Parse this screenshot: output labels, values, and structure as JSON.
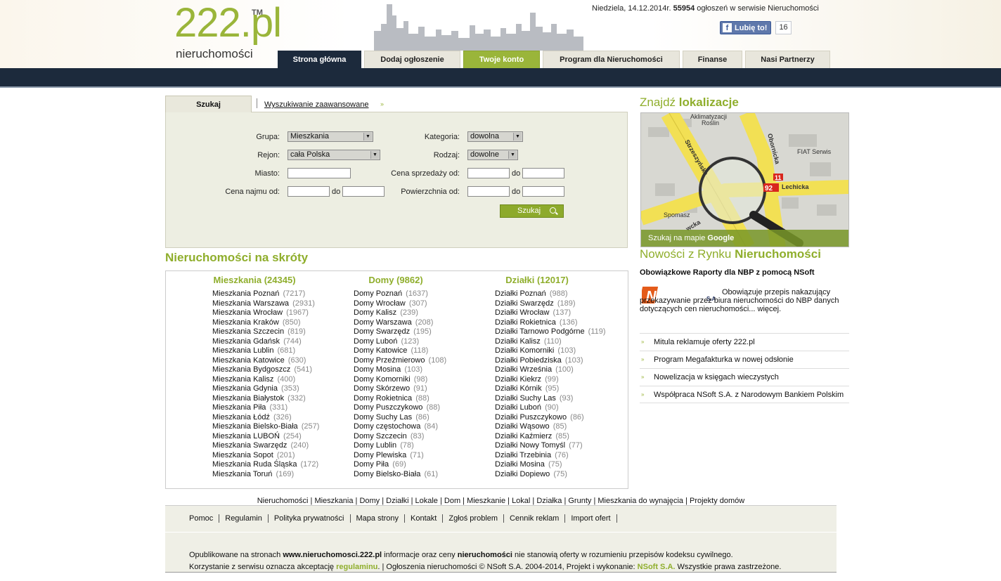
{
  "brand": {
    "logo_number": "222.pl",
    "logo_tm": "TM",
    "logo_sub": "nieruchomości"
  },
  "topbar": {
    "date": "Niedziela, 14.12.2014r.",
    "listings_count": "55954",
    "listings_text": "ogłoszeń w serwisie Nieruchomości",
    "fb_like_label": "Lubię to!",
    "fb_like_count": "16"
  },
  "tabs": [
    {
      "label": "Strona główna"
    },
    {
      "label": "Dodaj ogłoszenie"
    },
    {
      "label": "Twoje konto"
    },
    {
      "label": "Program dla Nieruchomości"
    },
    {
      "label": "Finanse"
    },
    {
      "label": "Nasi Partnerzy"
    }
  ],
  "search": {
    "tab_label": "Szukaj",
    "advanced_link": "Wyszukiwanie zaawansowane",
    "advanced_arrow": "»",
    "group_label": "Grupa:",
    "group_value": "Mieszkania",
    "region_label": "Rejon:",
    "region_value": "cała Polska",
    "city_label": "Miasto:",
    "rent_label": "Cena najmu od:",
    "category_label": "Kategoria:",
    "category_value": "dowolna",
    "type_label": "Rodzaj:",
    "type_value": "dowolne",
    "sale_label": "Cena sprzedaży od:",
    "area_label": "Powierzchnia od:",
    "to_label": "do",
    "submit_label": "Szukaj"
  },
  "shortcuts": {
    "title": "Nieruchomości na skróty",
    "columns": [
      {
        "title": "Mieszkania (24345)",
        "items": [
          {
            "name": "Mieszkania Poznań",
            "count": "(7217)"
          },
          {
            "name": "Mieszkania Warszawa",
            "count": "(2931)"
          },
          {
            "name": "Mieszkania Wrocław",
            "count": "(1967)"
          },
          {
            "name": "Mieszkania Kraków",
            "count": "(850)"
          },
          {
            "name": "Mieszkania Szczecin",
            "count": "(819)"
          },
          {
            "name": "Mieszkania Gdańsk",
            "count": "(744)"
          },
          {
            "name": "Mieszkania Lublin",
            "count": "(681)"
          },
          {
            "name": "Mieszkania Katowice",
            "count": "(630)"
          },
          {
            "name": "Mieszkania Bydgoszcz",
            "count": "(541)"
          },
          {
            "name": "Mieszkania Kalisz",
            "count": "(400)"
          },
          {
            "name": "Mieszkania Gdynia",
            "count": "(353)"
          },
          {
            "name": "Mieszkania Białystok",
            "count": "(332)"
          },
          {
            "name": "Mieszkania Piła",
            "count": "(331)"
          },
          {
            "name": "Mieszkania Łódź",
            "count": "(326)"
          },
          {
            "name": "Mieszkania Bielsko-Biała",
            "count": "(257)"
          },
          {
            "name": "Mieszkania LUBOŃ",
            "count": "(254)"
          },
          {
            "name": "Mieszkania Swarzędz",
            "count": "(240)"
          },
          {
            "name": "Mieszkania Sopot",
            "count": "(201)"
          },
          {
            "name": "Mieszkania Ruda Śląska",
            "count": "(172)"
          },
          {
            "name": "Mieszkania Toruń",
            "count": "(169)"
          }
        ]
      },
      {
        "title": "Domy (9862)",
        "items": [
          {
            "name": "Domy Poznań",
            "count": "(1637)"
          },
          {
            "name": "Domy Wrocław",
            "count": "(307)"
          },
          {
            "name": "Domy Kalisz",
            "count": "(239)"
          },
          {
            "name": "Domy Warszawa",
            "count": "(208)"
          },
          {
            "name": "Domy Swarzędz",
            "count": "(195)"
          },
          {
            "name": "Domy Luboń",
            "count": "(123)"
          },
          {
            "name": "Domy Katowice",
            "count": "(118)"
          },
          {
            "name": "Domy Przeźmierowo",
            "count": "(108)"
          },
          {
            "name": "Domy Mosina",
            "count": "(103)"
          },
          {
            "name": "Domy Komorniki",
            "count": "(98)"
          },
          {
            "name": "Domy Skórzewo",
            "count": "(91)"
          },
          {
            "name": "Domy Rokietnica",
            "count": "(88)"
          },
          {
            "name": "Domy Puszczykowo",
            "count": "(88)"
          },
          {
            "name": "Domy Suchy Las",
            "count": "(86)"
          },
          {
            "name": "Domy częstochowa",
            "count": "(84)"
          },
          {
            "name": "Domy Szczecin",
            "count": "(83)"
          },
          {
            "name": "Domy Lublin",
            "count": "(78)"
          },
          {
            "name": "Domy Plewiska",
            "count": "(71)"
          },
          {
            "name": "Domy Piła",
            "count": "(69)"
          },
          {
            "name": "Domy Bielsko-Biała",
            "count": "(61)"
          }
        ]
      },
      {
        "title": "Działki (12017)",
        "items": [
          {
            "name": "Działki Poznań",
            "count": "(988)"
          },
          {
            "name": "Działki Swarzędz",
            "count": "(189)"
          },
          {
            "name": "Działki Wrocław",
            "count": "(137)"
          },
          {
            "name": "Działki Rokietnica",
            "count": "(136)"
          },
          {
            "name": "Działki Tarnowo Podgórne",
            "count": "(119)"
          },
          {
            "name": "Działki Kalisz",
            "count": "(110)"
          },
          {
            "name": "Działki Komorniki",
            "count": "(103)"
          },
          {
            "name": "Działki Pobiedziska",
            "count": "(103)"
          },
          {
            "name": "Działki Września",
            "count": "(100)"
          },
          {
            "name": "Działki Kiekrz",
            "count": "(99)"
          },
          {
            "name": "Działki Kórnik",
            "count": "(95)"
          },
          {
            "name": "Działki Suchy Las",
            "count": "(93)"
          },
          {
            "name": "Działki Luboń",
            "count": "(90)"
          },
          {
            "name": "Działki Puszczykowo",
            "count": "(86)"
          },
          {
            "name": "Działki Wąsowo",
            "count": "(85)"
          },
          {
            "name": "Działki Kaźmierz",
            "count": "(85)"
          },
          {
            "name": "Działki Nowy Tomyśl",
            "count": "(77)"
          },
          {
            "name": "Działki Trzebinia",
            "count": "(76)"
          },
          {
            "name": "Działki Mosina",
            "count": "(75)"
          },
          {
            "name": "Działki Dopiewo",
            "count": "(75)"
          }
        ]
      }
    ]
  },
  "map": {
    "title_plain": "Znajdź ",
    "title_bold": "lokalizacje",
    "caption_plain": "Szukaj na mapie ",
    "caption_bold": "Google",
    "labels": {
      "aklimatyzacji": "Aklimatyzacji",
      "roslin": "Roślin",
      "strzeszynska": "Strzeszyńska",
      "obornicka": "Obornicka",
      "fiat": "FIAT Serwis",
      "lechicka": "Lechicka",
      "route_92": "92",
      "route_11": "11",
      "spomasz": "Spomasz",
      "street_partial": "wcka"
    }
  },
  "news": {
    "title_plain": "Nowości z Rynku ",
    "title_bold": "Nieruchomości",
    "headline": "Obowiązkowe Raporty dla NBP z pomocą NSoft",
    "logo_text": "NSOFT",
    "logo_suffix": "S.A",
    "body": "Obowiązuje przepis nakazujący przekazywanie przez biura nieruchomości do NBP danych dotyczących cen nieruchomości... więcej.",
    "items": [
      {
        "label": "Mitula reklamuje oferty 222.pl"
      },
      {
        "label": "Program Megafakturka w nowej odsłonie"
      },
      {
        "label": "Nowelizacja w księgach wieczystych"
      },
      {
        "label": "Współpraca NSoft S.A. z Narodowym Bankiem Polskim"
      }
    ],
    "arrow": "»"
  },
  "footer": {
    "links_line": "Nieruchomości | Mieszkania | Domy | Działki | Lokale | Dom | Mieszkanie | Lokal | Działka | Grunty | Mieszkania do wynajęcia | Projekty domów",
    "nav": [
      {
        "label": "Pomoc"
      },
      {
        "label": "Regulamin"
      },
      {
        "label": "Polityka prywatności"
      },
      {
        "label": "Mapa strony"
      },
      {
        "label": "Kontakt"
      },
      {
        "label": "Zgłoś problem"
      },
      {
        "label": "Cennik reklam"
      },
      {
        "label": "Import ofert"
      }
    ],
    "info1_a": "Opublikowane na stronach ",
    "info1_site": "www.nieruchomosci.222.pl",
    "info1_b": " informacje oraz ceny ",
    "info1_bold": "nieruchomości",
    "info1_c": " nie stanowią oferty w rozumieniu przepisów kodeksu cywilnego.",
    "info2_a": "Korzystanie z serwisu oznacza akceptację ",
    "info2_link": "regulaminu",
    "info2_b": ". | Ogłoszenia nieruchomości © NSoft S.A. 2004-2014, Projekt i wykonanie: ",
    "info2_author": "NSoft S.A.",
    "info2_c": " Wszystkie prawa zastrzeżone."
  },
  "colors": {
    "accent_green": "#9ab53a",
    "navy": "#1c2a3c",
    "panel_beige": "#edeee2"
  }
}
